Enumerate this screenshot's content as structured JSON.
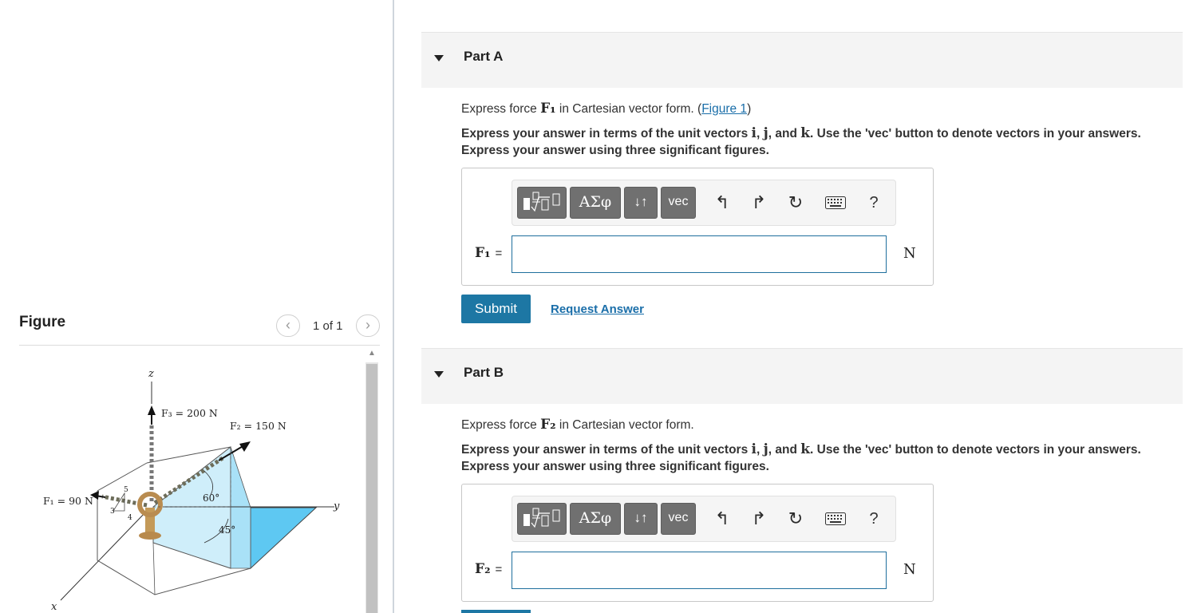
{
  "figure_panel": {
    "title": "Figure",
    "prev_icon": "chevron-left-icon",
    "next_icon": "chevron-right-icon",
    "pager_text": "1 of 1",
    "labels": {
      "z": "z",
      "x": "x",
      "y": "y",
      "f3": "F₃ = 200 N",
      "f2": "F₂ = 150 N",
      "f1": "F₁ = 90 N",
      "angle60": "60°",
      "angle45": "45°",
      "tri5": "5",
      "tri3": "3",
      "tri4": "4"
    }
  },
  "part_a": {
    "title": "Part A",
    "question_prefix": "Express force ",
    "question_symbol": "F₁",
    "question_suffix": " in Cartesian vector form. (",
    "figure_link": "Figure 1",
    "question_end": ")",
    "instructions": {
      "t1": "Express your answer in terms of the unit vectors ",
      "i": "i",
      "c1": ", ",
      "j": "j",
      "c2": ", and ",
      "k": "k",
      "t2": ". Use the 'vec' button to denote vectors in your answers.",
      "line2": "Express your answer using three significant figures."
    },
    "toolbar": {
      "greek": "ΑΣφ",
      "arrows": "↓↑",
      "vec": "vec",
      "undo": "↰",
      "redo": "↱",
      "reset": "↻",
      "help": "?"
    },
    "variable": "F₁",
    "equals": "=",
    "input_value": "",
    "unit": "N",
    "submit": "Submit",
    "request": "Request Answer"
  },
  "part_b": {
    "title": "Part B",
    "question_prefix": "Express force ",
    "question_symbol": "F₂",
    "question_suffix": " in Cartesian vector form.",
    "instructions": {
      "t1": "Express your answer in terms of the unit vectors ",
      "i": "i",
      "c1": ", ",
      "j": "j",
      "c2": ", and ",
      "k": "k",
      "t2": ". Use the 'vec' button to denote vectors in your answers.",
      "line2": "Express your answer using three significant figures."
    },
    "toolbar": {
      "greek": "ΑΣφ",
      "arrows": "↓↑",
      "vec": "vec",
      "undo": "↰",
      "redo": "↱",
      "reset": "↻",
      "help": "?"
    },
    "variable": "F₂",
    "equals": "=",
    "input_value": "",
    "unit": "N"
  },
  "colors": {
    "accent": "#1d77a4",
    "link": "#1a6ea9",
    "plane_fill": "#cfeefa",
    "plane_dark": "#5ec8f2",
    "toolbar_button": "#707070"
  }
}
